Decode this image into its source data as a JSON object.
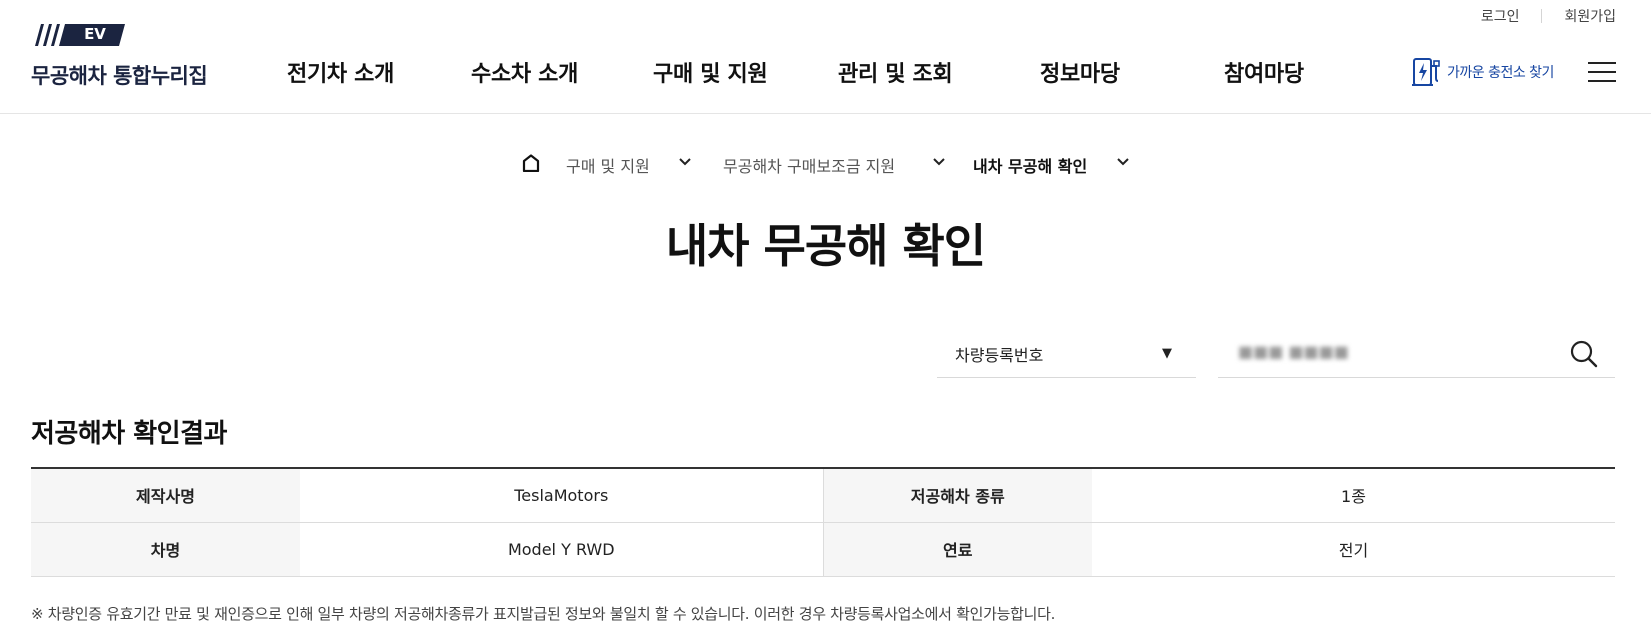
{
  "util": {
    "login": "로그인",
    "join": "회원가입"
  },
  "logo": {
    "badge": "EV",
    "site_name": "무공해차 통합누리집"
  },
  "gnb": [
    "전기차 소개",
    "수소차 소개",
    "구매 및 지원",
    "관리 및 조회",
    "정보마당",
    "참여마당"
  ],
  "charger": {
    "label": "가까운 충전소 찾기"
  },
  "breadcrumb": [
    "구매 및 지원",
    "무공해차 구매보조금 지원",
    "내차 무공해 확인"
  ],
  "page_title": "내차 무공해 확인",
  "search": {
    "select_value": "차량등록번호",
    "input_value": "■■■ ■■■■"
  },
  "result": {
    "title": "저공해차 확인결과",
    "rows": [
      {
        "h1": "제작사명",
        "v1": "TeslaMotors",
        "h2": "저공해차 종류",
        "v2": "1종"
      },
      {
        "h1": "차명",
        "v1": "Model Y RWD",
        "h2": "연료",
        "v2": "전기"
      }
    ]
  },
  "notice": "※ 차량인증 유효기간 만료 및 재인증으로 인해 일부 차량의 저공해차종류가 표지발급된 정보와 불일치 할 수 있습니다. 이러한 경우 차량등록사업소에서 확인가능합니다.",
  "colors": {
    "brand_navy": "#1b2440",
    "link_blue": "#1746a2"
  }
}
